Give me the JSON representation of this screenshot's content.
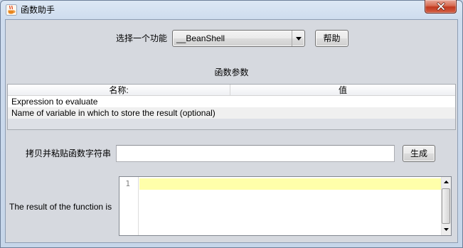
{
  "window": {
    "title": "函数助手",
    "icons": {
      "app": "java-coffee-icon",
      "close": "close-icon"
    },
    "colors": {
      "title_bar": "#d6e3f2",
      "client_background": "#d6d9df",
      "close_button": "#c8472f"
    }
  },
  "function_selector": {
    "label": "选择一个功能",
    "selected": "__BeanShell",
    "dropdown_icon": "chevron-down-icon",
    "help_label": "帮助"
  },
  "parameters": {
    "title": "函数参数",
    "columns": [
      "名称:",
      "值"
    ],
    "rows": [
      {
        "name": "Expression to evaluate",
        "value": ""
      },
      {
        "name": "Name of variable in which to store the result (optional)",
        "value": ""
      }
    ]
  },
  "function_string": {
    "label": "拷贝并粘贴函数字符串",
    "value": "",
    "generate_label": "生成"
  },
  "result": {
    "label": "The result of the function is",
    "line_numbers": [
      "1"
    ],
    "text": "",
    "current_line_highlight": "#ffffaa",
    "scroll_icons": [
      "scroll-up-arrow-icon",
      "scroll-down-arrow-icon"
    ]
  }
}
